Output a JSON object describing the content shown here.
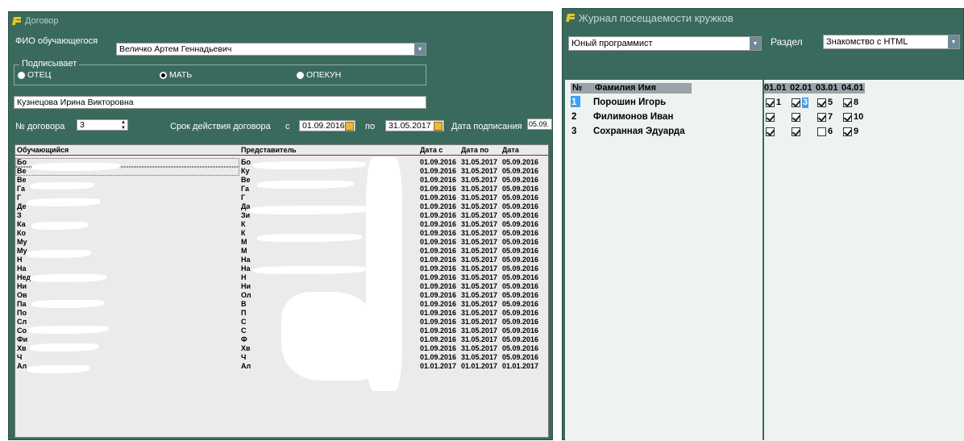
{
  "contract": {
    "title": "Договор",
    "fio_label": "ФИО обучающегося",
    "fio_value": "Величко Артем Геннадьевич",
    "signer_legend": "Подписывает",
    "signer_options": [
      "ОТЕЦ",
      "МАТЬ",
      "ОПЕКУН"
    ],
    "signer_selected": "МАТЬ",
    "signer_name": "Кузнецова Ирина Викторовна",
    "contract_no_label": "№ договора",
    "contract_no": "3",
    "period_label": "Срок действия договора",
    "from_label": "с",
    "date_from": "01.09.2016",
    "to_label": "по",
    "date_to": "31.05.2017",
    "signed_label": "Дата подписания",
    "signed_value": "05.09.",
    "table": {
      "headers": [
        "Обучающийся",
        "Представитель",
        "Дата с",
        "Дата по",
        "Дата"
      ],
      "rows": [
        {
          "student": "Бо",
          "rep": "Бо",
          "d1": "01.09.2016",
          "d2": "31.05.2017",
          "d3": "05.09.2016"
        },
        {
          "student": "Ве",
          "rep": "Ку",
          "d1": "01.09.2016",
          "d2": "31.05.2017",
          "d3": "05.09.2016"
        },
        {
          "student": "Ве",
          "rep": "Ве",
          "d1": "01.09.2016",
          "d2": "31.05.2017",
          "d3": "05.09.2016"
        },
        {
          "student": "Га",
          "rep": "Га",
          "d1": "01.09.2016",
          "d2": "31.05.2017",
          "d3": "05.09.2016"
        },
        {
          "student": "Г",
          "rep": "Г",
          "d1": "01.09.2016",
          "d2": "31.05.2017",
          "d3": "05.09.2016"
        },
        {
          "student": "Де",
          "rep": "Да",
          "d1": "01.09.2016",
          "d2": "31.05.2017",
          "d3": "05.09.2016"
        },
        {
          "student": "З",
          "rep": "Зи",
          "d1": "01.09.2016",
          "d2": "31.05.2017",
          "d3": "05.09.2016"
        },
        {
          "student": "Ка",
          "rep": "К",
          "d1": "01.09.2016",
          "d2": "31.05.2017",
          "d3": "05.09.2016"
        },
        {
          "student": "Ко",
          "rep": "К",
          "d1": "01.09.2016",
          "d2": "31.05.2017",
          "d3": "05.09.2016"
        },
        {
          "student": "Му",
          "rep": "М",
          "d1": "01.09.2016",
          "d2": "31.05.2017",
          "d3": "05.09.2016"
        },
        {
          "student": "Му",
          "rep": "М",
          "d1": "01.09.2016",
          "d2": "31.05.2017",
          "d3": "05.09.2016"
        },
        {
          "student": "Н",
          "rep": "На",
          "d1": "01.09.2016",
          "d2": "31.05.2017",
          "d3": "05.09.2016"
        },
        {
          "student": "На",
          "rep": "На",
          "d1": "01.09.2016",
          "d2": "31.05.2017",
          "d3": "05.09.2016"
        },
        {
          "student": "Нед",
          "rep": "Н",
          "d1": "01.09.2016",
          "d2": "31.05.2017",
          "d3": "05.09.2016"
        },
        {
          "student": "Ни",
          "rep": "Ни",
          "d1": "01.09.2016",
          "d2": "31.05.2017",
          "d3": "05.09.2016"
        },
        {
          "student": "Ов",
          "rep": "Ол",
          "d1": "01.09.2016",
          "d2": "31.05.2017",
          "d3": "05.09.2016"
        },
        {
          "student": "Па",
          "rep": "В",
          "d1": "01.09.2016",
          "d2": "31.05.2017",
          "d3": "05.09.2016"
        },
        {
          "student": "По",
          "rep": "П",
          "d1": "01.09.2016",
          "d2": "31.05.2017",
          "d3": "05.09.2016"
        },
        {
          "student": "Сл",
          "rep": "С",
          "d1": "01.09.2016",
          "d2": "31.05.2017",
          "d3": "05.09.2016"
        },
        {
          "student": "Со",
          "rep": "С",
          "d1": "01.09.2016",
          "d2": "31.05.2017",
          "d3": "05.09.2016"
        },
        {
          "student": "Фи",
          "rep": "Ф",
          "d1": "01.09.2016",
          "d2": "31.05.2017",
          "d3": "05.09.2016"
        },
        {
          "student": "Хв",
          "rep": "Хв",
          "d1": "01.09.2016",
          "d2": "31.05.2017",
          "d3": "05.09.2016"
        },
        {
          "student": "Ч",
          "rep": "Ч",
          "d1": "01.09.2016",
          "d2": "31.05.2017",
          "d3": "05.09.2016"
        },
        {
          "student": "Ал",
          "rep": "Ал",
          "d1": "01.01.2017",
          "d2": "01.01.2017",
          "d3": "01.01.2017"
        }
      ]
    }
  },
  "journal": {
    "title": "Журнал посещаемости кружков",
    "club_value": "Юный программист",
    "section_label": "Раздел",
    "section_value": "Знакомство с HTML",
    "headers": {
      "num": "№",
      "name": "Фамилия Имя"
    },
    "dates": [
      "01.01",
      "02.01",
      "03.01",
      "04.01"
    ],
    "students": [
      {
        "num": "1",
        "name": "Порошин Игорь"
      },
      {
        "num": "2",
        "name": "Филимонов Иван"
      },
      {
        "num": "3",
        "name": "Сохранная Эдуарда"
      }
    ],
    "attendance": [
      [
        {
          "checked": true,
          "label": "1"
        },
        {
          "checked": true,
          "label": "3"
        },
        {
          "checked": true,
          "label": "5"
        },
        {
          "checked": true,
          "label": "8"
        }
      ],
      [
        {
          "checked": true,
          "label": ""
        },
        {
          "checked": true,
          "label": ""
        },
        {
          "checked": true,
          "label": "7"
        },
        {
          "checked": true,
          "label": "10"
        }
      ],
      [
        {
          "checked": true,
          "label": ""
        },
        {
          "checked": true,
          "label": ""
        },
        {
          "checked": false,
          "label": "6"
        },
        {
          "checked": true,
          "label": "9"
        }
      ]
    ],
    "colors": {
      "selection": "#3aa0f0",
      "window_bg": "#3a6a5e",
      "panel_bg": "#eef3f1"
    }
  }
}
